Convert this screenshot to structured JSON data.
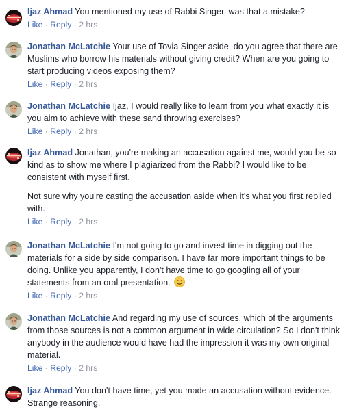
{
  "comments": [
    {
      "author": "Ijaz Ahmad",
      "text": "You mentioned my use of Rabbi Singer, was that a mistake?",
      "like": "Like",
      "reply": "Reply",
      "time": "2 hrs",
      "avatar_icon": "ijaz-avatar-icon"
    },
    {
      "author": "Jonathan McLatchie",
      "text": "Your use of Tovia Singer aside, do you agree that there are Muslims who borrow his materials without giving credit? When are you going to start producing videos exposing them?",
      "like": "Like",
      "reply": "Reply",
      "time": "2 hrs",
      "avatar_icon": "jonathan-avatar-icon"
    },
    {
      "author": "Jonathan McLatchie",
      "text": "Ijaz, I would really like to learn from you what exactly it is you aim to achieve with these sand throwing exercises?",
      "like": "Like",
      "reply": "Reply",
      "time": "2 hrs",
      "avatar_icon": "jonathan-avatar-icon"
    },
    {
      "author": "Ijaz Ahmad",
      "text": "Jonathan, you're making an accusation against me, would you be so kind as to show me where I plagiarized from the Rabbi? I would like to be consistent with myself first.",
      "text2": "Not sure why you're casting the accusation aside when it's what you first replied with.",
      "like": "Like",
      "reply": "Reply",
      "time": "2 hrs",
      "avatar_icon": "ijaz-avatar-icon"
    },
    {
      "author": "Jonathan McLatchie",
      "text": "I'm not going to go and invest time in digging out the materials for a side by side comparison. I have far more important things to be doing. Unlike you apparently, I don't have time to go googling all of your statements from an oral presentation.",
      "emoji": "wink-emoji-icon",
      "like": "Like",
      "reply": "Reply",
      "time": "2 hrs",
      "avatar_icon": "jonathan-avatar-icon"
    },
    {
      "author": "Jonathan McLatchie",
      "text": "And regarding my use of sources, which of the arguments from those sources is not a common argument in wide circulation? So I don't think anybody in the audience would have had the impression it was my own original material.",
      "like": "Like",
      "reply": "Reply",
      "time": "2 hrs",
      "avatar_icon": "jonathan-avatar-icon"
    },
    {
      "author": "Ijaz Ahmad",
      "text": "You don't have time, yet you made an accusation without evidence. Strange reasoning.",
      "avatar_icon": "ijaz-avatar-icon"
    }
  ],
  "colors": {
    "author": "#365899",
    "action": "#4267b2",
    "meta": "#90949c",
    "text": "#1d2129"
  }
}
